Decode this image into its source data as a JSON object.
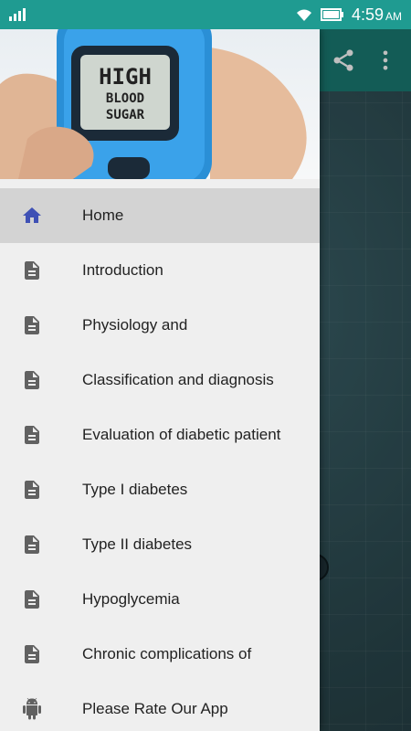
{
  "status_bar": {
    "time": "4:59",
    "ampm": "AM"
  },
  "menu": {
    "items": [
      {
        "label": "Home",
        "icon": "home-icon",
        "active": true
      },
      {
        "label": "Introduction",
        "icon": "document-icon"
      },
      {
        "label": "Physiology and",
        "icon": "document-icon"
      },
      {
        "label": "Classification and diagnosis",
        "icon": "document-icon"
      },
      {
        "label": "Evaluation of diabetic patient",
        "icon": "document-icon"
      },
      {
        "label": "Type I diabetes",
        "icon": "document-icon"
      },
      {
        "label": "Type II diabetes",
        "icon": "document-icon"
      },
      {
        "label": "Hypoglycemia",
        "icon": "document-icon"
      },
      {
        "label": "Chronic complications of",
        "icon": "document-icon"
      },
      {
        "label": "Please Rate Our App",
        "icon": "android-icon"
      }
    ]
  },
  "header_image": {
    "meter_text": [
      "HIGH",
      "BLOOD",
      "SUGAR"
    ]
  },
  "colors": {
    "status_bar": "#1f9b91",
    "toolbar": "#1a7b73",
    "home_icon": "#3f51b5",
    "doc_icon": "#616161",
    "drawer_bg": "#efefef",
    "active_bg": "#d3d3d3"
  }
}
